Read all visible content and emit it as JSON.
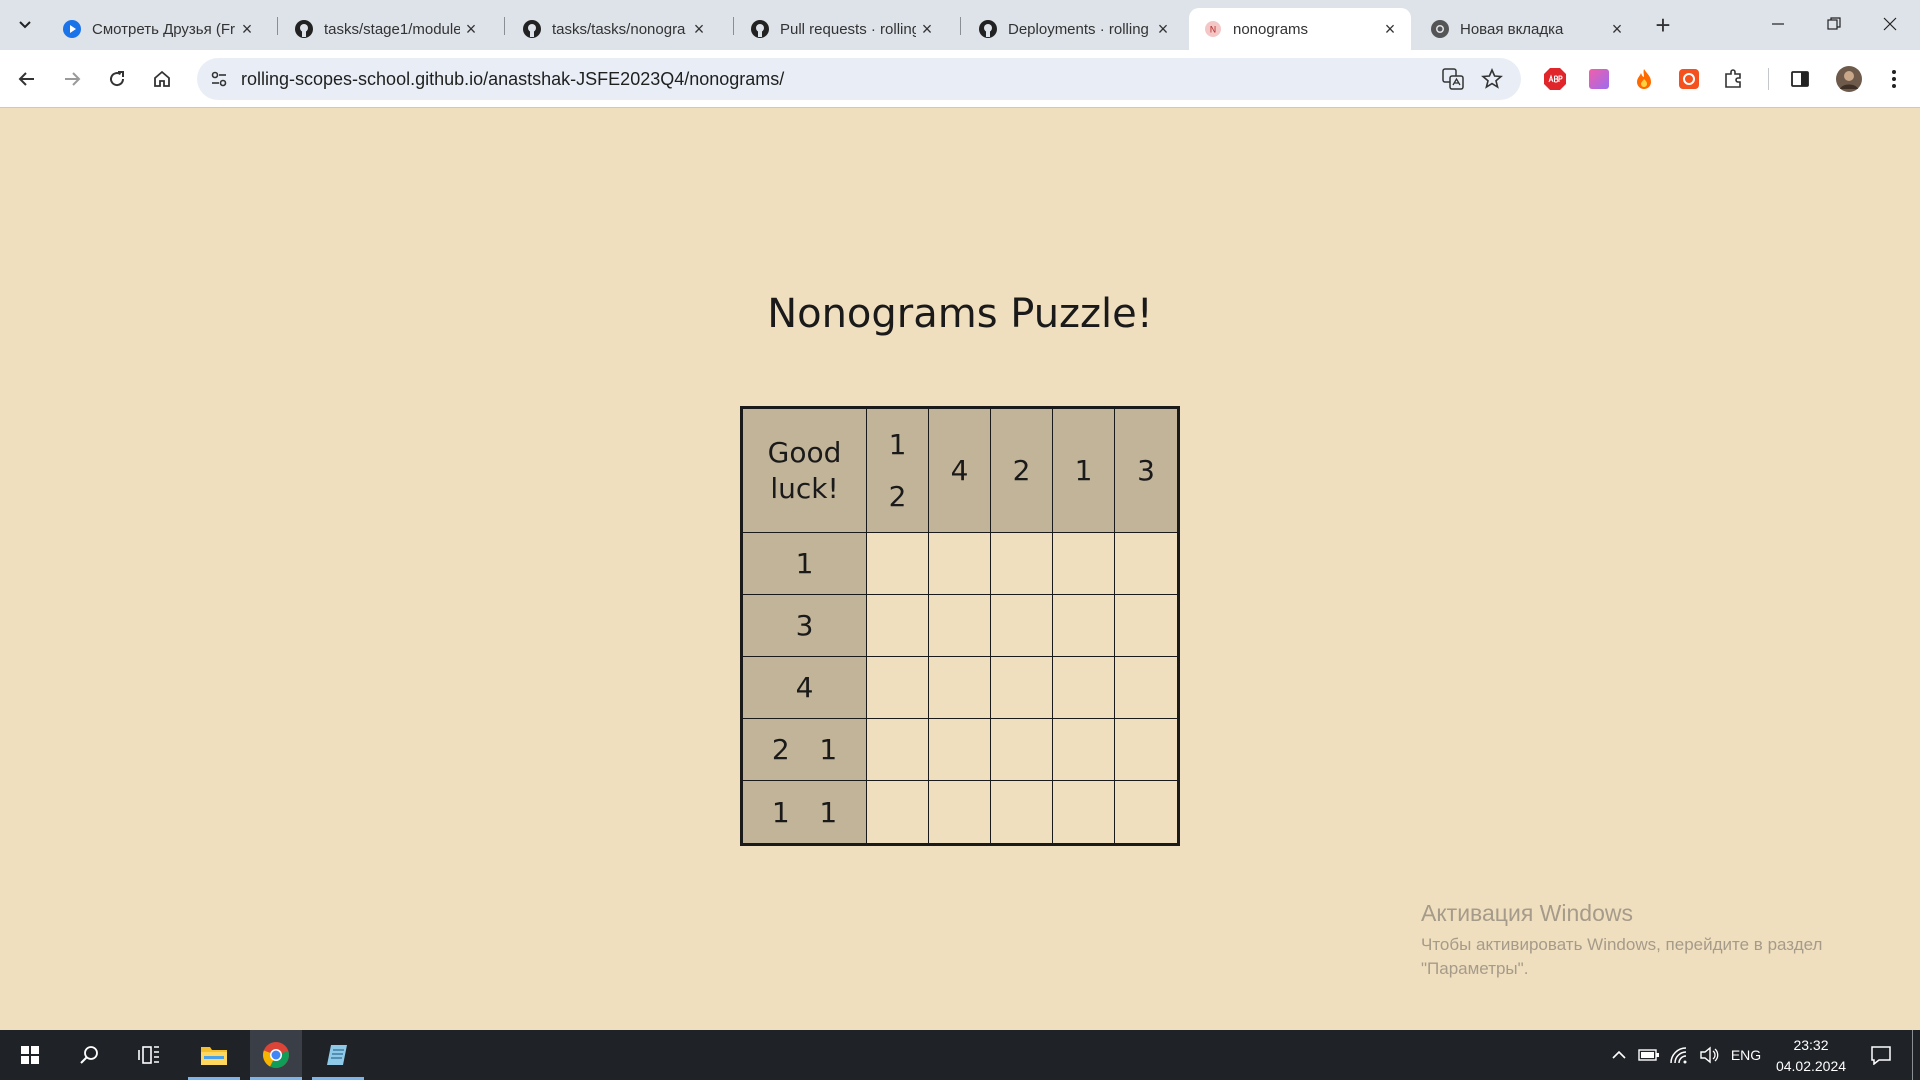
{
  "browser": {
    "tabs": [
      {
        "title": "Смотреть Друзья (Fr",
        "icon": "play-icon",
        "active": false
      },
      {
        "title": "tasks/stage1/module",
        "icon": "github-icon",
        "active": false
      },
      {
        "title": "tasks/tasks/nonogra",
        "icon": "github-icon",
        "active": false
      },
      {
        "title": "Pull requests · rolling",
        "icon": "github-icon",
        "active": false
      },
      {
        "title": "Deployments · rolling",
        "icon": "github-icon",
        "active": false
      },
      {
        "title": "nonograms",
        "icon": "nonograms-favicon",
        "active": true
      },
      {
        "title": "Новая вкладка",
        "icon": "chrome-icon",
        "active": false
      }
    ],
    "new_tab_label": "+",
    "url": "rolling-scopes-school.github.io/anastshak-JSFE2023Q4/nonograms/",
    "favicon_letter": "N"
  },
  "page": {
    "title": "Nonograms Puzzle!",
    "corner_line1": "Good",
    "corner_line2": "luck!",
    "column_clues": [
      [
        "1",
        "2"
      ],
      [
        "4"
      ],
      [
        "2"
      ],
      [
        "1"
      ],
      [
        "3"
      ]
    ],
    "row_clues": [
      [
        "1"
      ],
      [
        "3"
      ],
      [
        "4"
      ],
      [
        "2",
        "1"
      ],
      [
        "1",
        "1"
      ]
    ]
  },
  "activation": {
    "title": "Активация Windows",
    "text": "Чтобы активировать Windows, перейдите в раздел \"Параметры\"."
  },
  "taskbar": {
    "language": "ENG",
    "time": "23:32",
    "date": "04.02.2024"
  },
  "colors": {
    "page_bg": "#f0dfbf",
    "clue_bg": "#c2b498",
    "grid_line": "#1a1a1a"
  }
}
